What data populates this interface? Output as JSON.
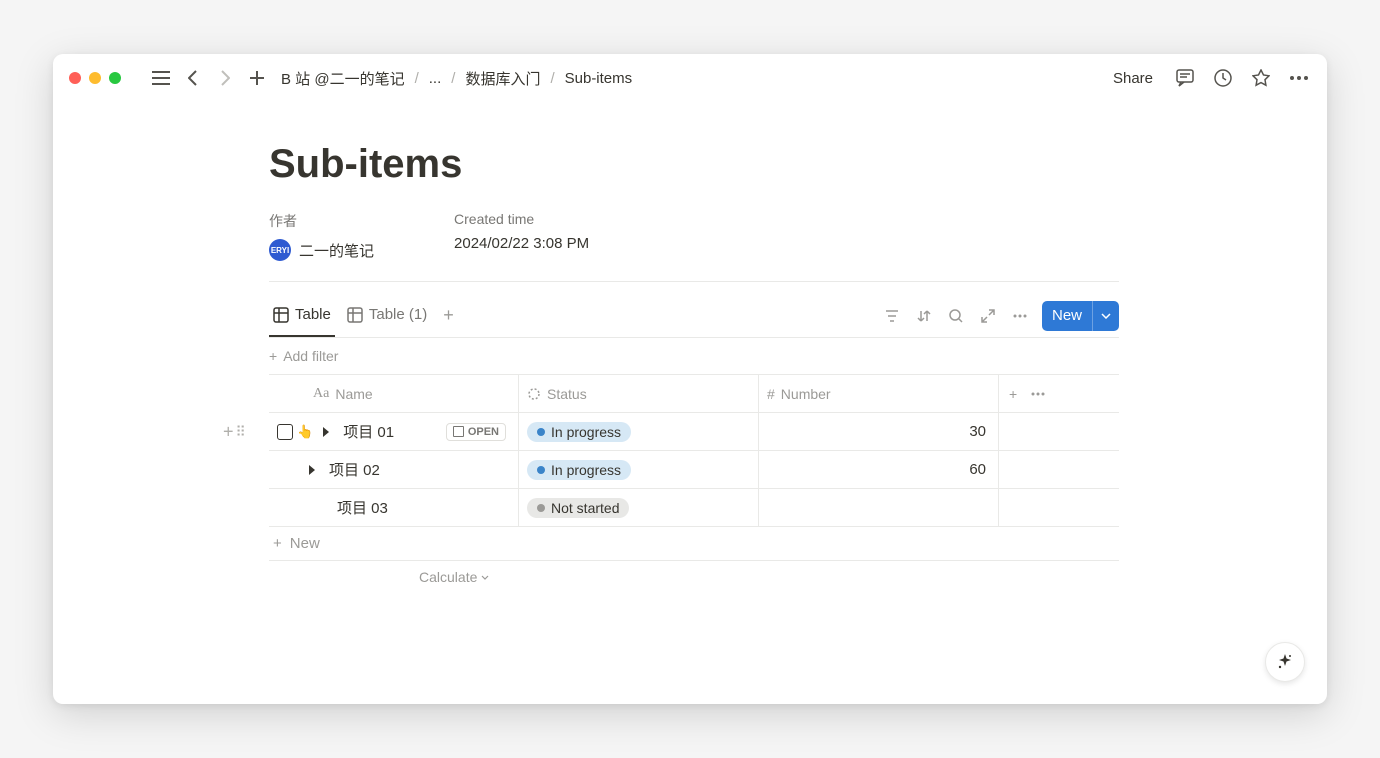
{
  "breadcrumb": {
    "root": "B 站 @二一的笔记",
    "ellipsis": "...",
    "parent": "数据库入门",
    "current": "Sub-items"
  },
  "topbar": {
    "share": "Share"
  },
  "page": {
    "title": "Sub-items"
  },
  "properties": {
    "author_label": "作者",
    "author_name": "二一的笔记",
    "author_badge": "ERYI",
    "created_label": "Created time",
    "created_value": "2024/02/22 3:08 PM"
  },
  "tabs": {
    "tab1": "Table",
    "tab2": "Table (1)"
  },
  "toolbar": {
    "new_label": "New"
  },
  "filter": {
    "add_filter": "Add filter"
  },
  "columns": {
    "name": "Name",
    "status": "Status",
    "number": "Number"
  },
  "statuses": {
    "in_progress": "In progress",
    "not_started": "Not started"
  },
  "rows": [
    {
      "name": "项目 01",
      "status": "in_progress",
      "number": "30",
      "open": true,
      "checkbox": true,
      "cursor": true
    },
    {
      "name": "项目 02",
      "status": "in_progress",
      "number": "60"
    },
    {
      "name": "项目 03",
      "status": "not_started",
      "number": ""
    }
  ],
  "row_actions": {
    "open": "OPEN"
  },
  "footer": {
    "new_row": "New",
    "calculate": "Calculate"
  }
}
